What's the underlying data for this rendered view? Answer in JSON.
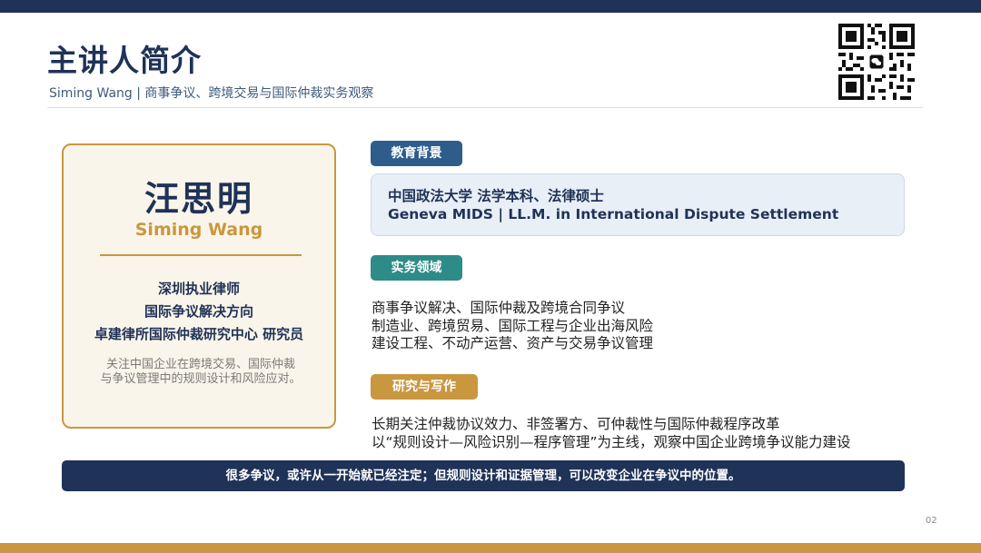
{
  "header": {
    "title": "主讲人简介",
    "subtitle": "Siming Wang | 商事争议、跨境交易与国际仲裁实务观察"
  },
  "profile": {
    "name_cn": "汪思明",
    "name_en": "Siming Wang",
    "roles": [
      "深圳执业律师",
      "国际争议解决方向",
      "卓建律所国际仲裁研究中心 研究员"
    ],
    "description": [
      "关注中国企业在跨境交易、国际仲裁",
      "与争议管理中的规则设计和风险应对。"
    ]
  },
  "sections": {
    "education": {
      "label": "教育背景",
      "lines": [
        "中国政法大学 法学本科、法律硕士",
        "Geneva MIDS | LL.M. in International Dispute Settlement"
      ]
    },
    "practice": {
      "label": "实务领域",
      "lines": [
        "商事争议解决、国际仲裁及跨境合同争议",
        "制造业、跨境贸易、国际工程与企业出海风险",
        "建设工程、不动产运营、资产与交易争议管理"
      ]
    },
    "research": {
      "label": "研究与写作",
      "lines": [
        "长期关注仲裁协议效力、非签署方、可仲裁性与国际仲裁程序改革",
        "以“规则设计—风险识别—程序管理”为主线，观察中国企业跨境争议能力建设"
      ]
    }
  },
  "quote": "很多争议，或许从一开始就已经注定；但规则设计和证据管理，可以改变企业在争议中的位置。",
  "page_number": "02",
  "colors": {
    "navy": "#1f3257",
    "gold": "#c9973f",
    "blue_tag": "#2e5d8c",
    "teal_tag": "#2e8c88",
    "card_bg": "#faf5ea",
    "edu_box_bg": "#e9eff6"
  },
  "icons": {
    "qr": "wechat-qr-code-icon"
  }
}
